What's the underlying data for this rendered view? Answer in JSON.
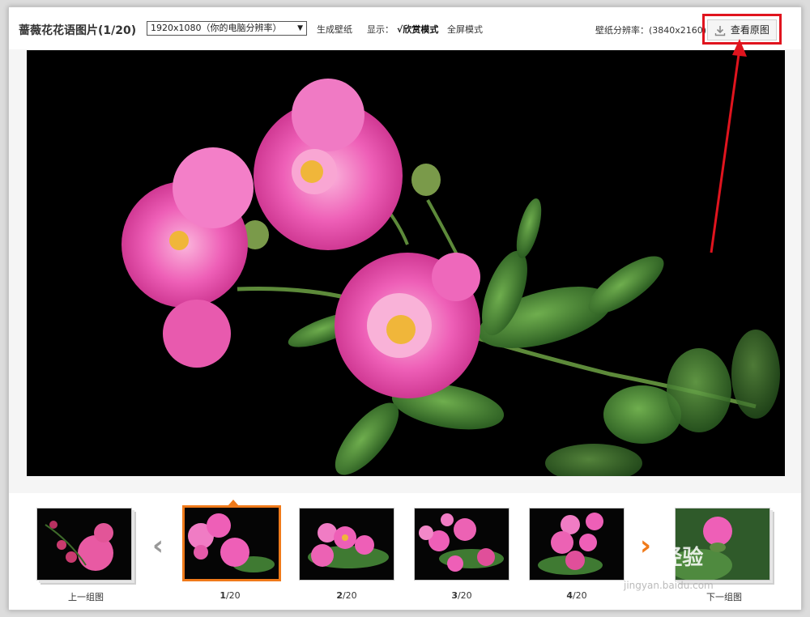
{
  "toolbar": {
    "title": "蔷薇花花语图片(1/20)",
    "resolution_select": "1920x1080（你的电脑分辨率）",
    "generate_wallpaper": "生成壁纸",
    "display_label": "显示：",
    "view_mode": "√欣赏模式",
    "fullscreen_mode": "全屏模式",
    "wallpaper_resolution": "壁纸分辨率：(3840x2160)",
    "view_original": "查看原图"
  },
  "thumbnails": [
    {
      "label": "上一组图",
      "type": "prev-group"
    },
    {
      "label_num": "1",
      "label_total": "/20",
      "active": true
    },
    {
      "label_num": "2",
      "label_total": "/20"
    },
    {
      "label_num": "3",
      "label_total": "/20"
    },
    {
      "label_num": "4",
      "label_total": "/20"
    },
    {
      "label": "下一组图",
      "type": "next-group"
    }
  ],
  "watermark": {
    "text": "Bai经验",
    "sub": "jingyan.baidu.com"
  },
  "colors": {
    "highlight": "#e0141e",
    "active_thumb": "#f07a1a",
    "flower_pink": "#ee5fb7"
  }
}
